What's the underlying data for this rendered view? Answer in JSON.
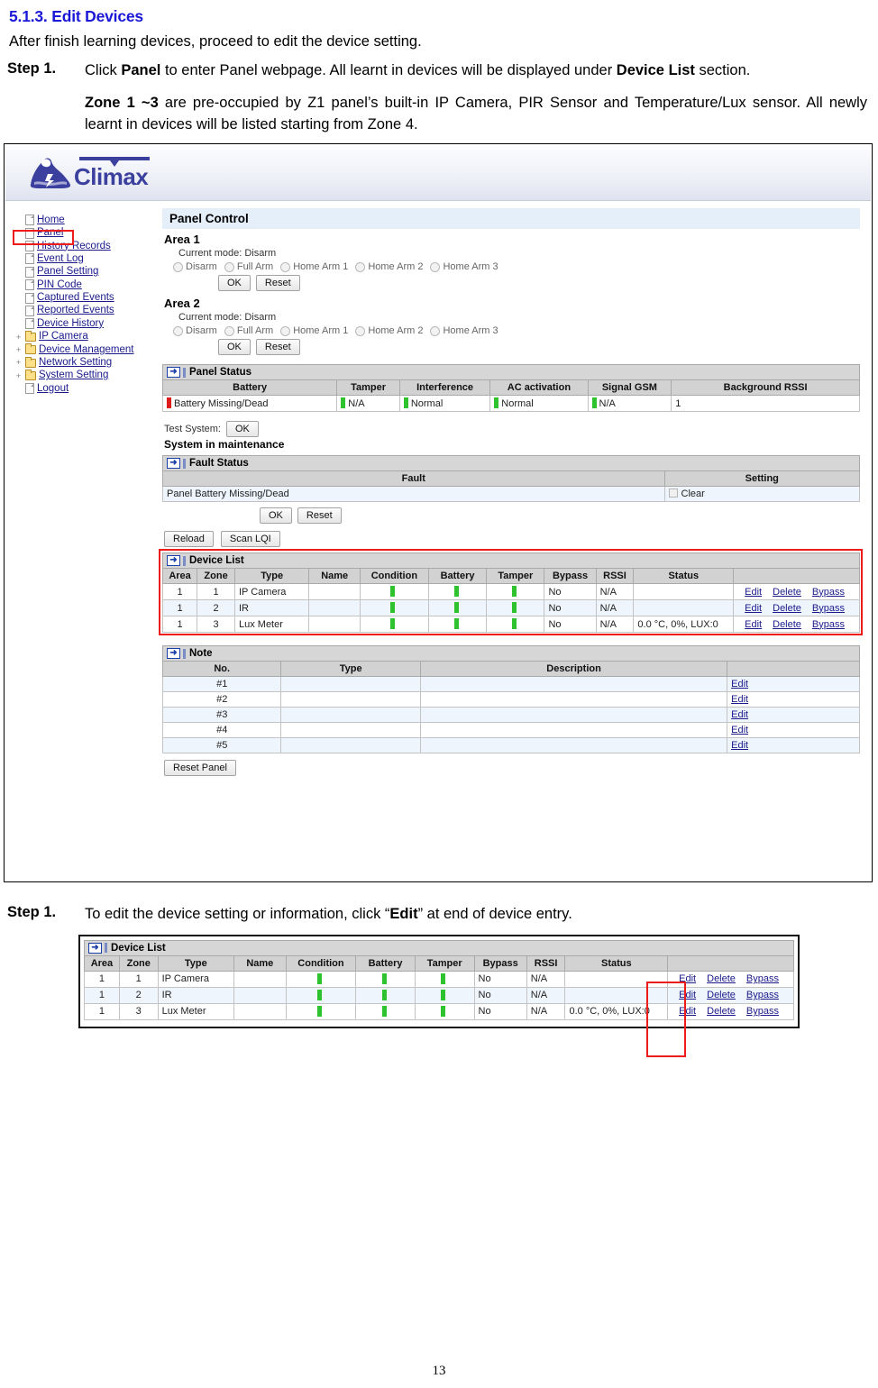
{
  "document": {
    "section_number_title": "5.1.3. Edit Devices",
    "intro": "After finish learning devices, proceed to edit the device setting.",
    "step1_label": "Step 1.",
    "step1_text_a": "Click ",
    "step1_bold_a": "Panel",
    "step1_text_b": " to enter Panel webpage. All learnt in devices will be displayed under ",
    "step1_bold_b": "Device List",
    "step1_text_c": " section.",
    "step1_sub_bold": "Zone 1 ~3",
    "step1_sub_text": " are pre-occupied by Z1 panel’s built-in IP Camera, PIR Sensor and Temperature/Lux sensor. All newly learnt in devices will be listed starting from Zone 4.",
    "step2_label": "Step 1.",
    "step2_text_a": "To edit the device setting or information, click “",
    "step2_bold": "Edit",
    "step2_text_b": "” at end of device entry.",
    "page_number": "13"
  },
  "brand": {
    "name": "Climax",
    "logo_color": "#3b3f9e"
  },
  "sidebar": {
    "items": [
      {
        "label": "Home",
        "icon": "page-icon",
        "expandable": false
      },
      {
        "label": "Panel",
        "icon": "page-icon",
        "expandable": false
      },
      {
        "label": "History Records",
        "icon": "page-icon",
        "expandable": false
      },
      {
        "label": "Event Log",
        "icon": "page-icon",
        "expandable": false
      },
      {
        "label": "Panel Setting",
        "icon": "page-icon",
        "expandable": false
      },
      {
        "label": "PIN Code",
        "icon": "page-icon",
        "expandable": false
      },
      {
        "label": "Captured Events",
        "icon": "page-icon",
        "expandable": false
      },
      {
        "label": "Reported Events",
        "icon": "page-icon",
        "expandable": false
      },
      {
        "label": "Device History",
        "icon": "page-icon",
        "expandable": false
      },
      {
        "label": "IP Camera",
        "icon": "folder-icon",
        "expandable": true
      },
      {
        "label": "Device Management",
        "icon": "folder-icon",
        "expandable": true
      },
      {
        "label": "Network Setting",
        "icon": "folder-icon",
        "expandable": true
      },
      {
        "label": "System Setting",
        "icon": "folder-icon",
        "expandable": true
      },
      {
        "label": "Logout",
        "icon": "page-icon",
        "expandable": false
      }
    ],
    "highlighted_item": "Panel",
    "highlight_color": "#ee1b1b"
  },
  "panel_control": {
    "title": "Panel Control",
    "areas": [
      {
        "title": "Area 1",
        "current_mode_label": "Current mode:",
        "current_mode_value": "Disarm",
        "modes": [
          "Disarm",
          "Full Arm",
          "Home Arm 1",
          "Home Arm 2",
          "Home Arm 3"
        ],
        "ok_label": "OK",
        "reset_label": "Reset"
      },
      {
        "title": "Area 2",
        "current_mode_label": "Current mode:",
        "current_mode_value": "Disarm",
        "modes": [
          "Disarm",
          "Full Arm",
          "Home Arm 1",
          "Home Arm 2",
          "Home Arm 3"
        ],
        "ok_label": "OK",
        "reset_label": "Reset"
      }
    ]
  },
  "panel_status": {
    "title": "Panel Status",
    "headers": [
      "Battery",
      "Tamper",
      "Interference",
      "AC activation",
      "Signal GSM",
      "Background RSSI"
    ],
    "row": [
      {
        "text": "Battery Missing/Dead",
        "led": "red"
      },
      {
        "text": "N/A",
        "led": "green"
      },
      {
        "text": "Normal",
        "led": "green"
      },
      {
        "text": "Normal",
        "led": "green"
      },
      {
        "text": "N/A",
        "led": "green"
      },
      {
        "text": "1",
        "led": "none"
      }
    ]
  },
  "test_system": {
    "label": "Test System:",
    "ok_label": "OK",
    "maintenance_text": "System in maintenance"
  },
  "fault_status": {
    "title": "Fault Status",
    "headers": [
      "Fault",
      "Setting"
    ],
    "rows": [
      {
        "fault": "Panel Battery Missing/Dead",
        "setting": "Clear"
      }
    ],
    "ok_label": "OK",
    "reset_label": "Reset"
  },
  "toolbar": {
    "reload_label": "Reload",
    "scan_lqi_label": "Scan LQI",
    "reset_panel_label": "Reset Panel"
  },
  "device_list": {
    "title": "Device List",
    "headers": [
      "Area",
      "Zone",
      "Type",
      "Name",
      "Condition",
      "Battery",
      "Tamper",
      "Bypass",
      "RSSI",
      "Status",
      ""
    ],
    "rows": [
      {
        "area": "1",
        "zone": "1",
        "type": "IP Camera",
        "name": "",
        "condition_led": "green",
        "battery_led": "green",
        "tamper_led": "green",
        "bypass": "No",
        "rssi": "N/A",
        "status": "",
        "actions": [
          "Edit",
          "Delete",
          "Bypass"
        ]
      },
      {
        "area": "1",
        "zone": "2",
        "type": "IR",
        "name": "",
        "condition_led": "green",
        "battery_led": "green",
        "tamper_led": "green",
        "bypass": "No",
        "rssi": "N/A",
        "status": "",
        "actions": [
          "Edit",
          "Delete",
          "Bypass"
        ]
      },
      {
        "area": "1",
        "zone": "3",
        "type": "Lux Meter",
        "name": "",
        "condition_led": "green",
        "battery_led": "green",
        "tamper_led": "green",
        "bypass": "No",
        "rssi": "N/A",
        "status": "0.0 °C, 0%, LUX:0",
        "actions": [
          "Edit",
          "Delete",
          "Bypass"
        ]
      }
    ]
  },
  "note": {
    "title": "Note",
    "headers": [
      "No.",
      "Type",
      "Description",
      ""
    ],
    "rows": [
      {
        "no": "#1",
        "type": "",
        "description": "",
        "action": "Edit"
      },
      {
        "no": "#2",
        "type": "",
        "description": "",
        "action": "Edit"
      },
      {
        "no": "#3",
        "type": "",
        "description": "",
        "action": "Edit"
      },
      {
        "no": "#4",
        "type": "",
        "description": "",
        "action": "Edit"
      },
      {
        "no": "#5",
        "type": "",
        "description": "",
        "action": "Edit"
      }
    ]
  }
}
